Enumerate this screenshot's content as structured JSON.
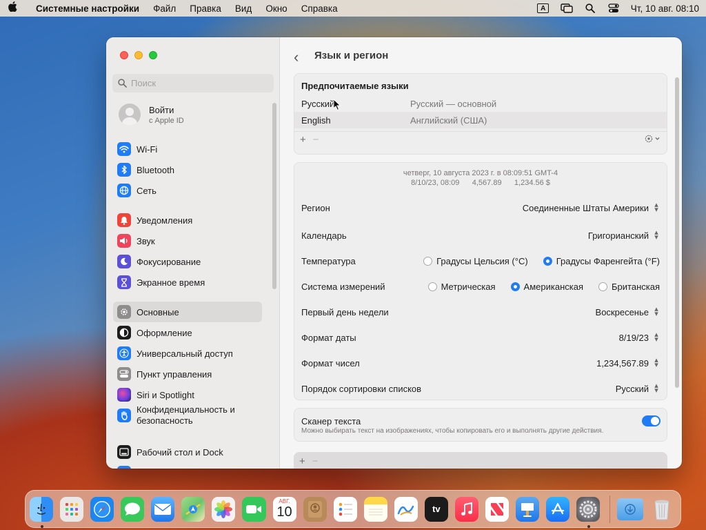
{
  "menubar": {
    "apple": "",
    "app_name": "Системные настройки",
    "menus": [
      "Файл",
      "Правка",
      "Вид",
      "Окно",
      "Справка"
    ],
    "input_indicator": "A",
    "clock": "Чт, 10 авг.  08:10"
  },
  "sidebar": {
    "search_placeholder": "Поиск",
    "account": {
      "name": "Войти",
      "sub": "с Apple ID"
    },
    "items": [
      {
        "label": "Wi-Fi",
        "icon": "wifi-icon",
        "color": "#1f7cf5"
      },
      {
        "label": "Bluetooth",
        "icon": "bluetooth-icon",
        "color": "#1f7cf5"
      },
      {
        "label": "Сеть",
        "icon": "globe-icon",
        "color": "#1f7cf5"
      },
      {
        "label": "Уведомления",
        "icon": "bell-icon",
        "color": "#f0443a"
      },
      {
        "label": "Звук",
        "icon": "speaker-icon",
        "color": "#f0445d"
      },
      {
        "label": "Фокусирование",
        "icon": "moon-icon",
        "color": "#5b50d6"
      },
      {
        "label": "Экранное время",
        "icon": "hourglass-icon",
        "color": "#5b50d6"
      },
      {
        "label": "Основные",
        "icon": "gear-icon",
        "color": "#8e8c8c"
      },
      {
        "label": "Оформление",
        "icon": "appearance-icon",
        "color": "#1d1d1d"
      },
      {
        "label": "Универсальный доступ",
        "icon": "accessibility-icon",
        "color": "#1f7cf5"
      },
      {
        "label": "Пункт управления",
        "icon": "control-center-icon",
        "color": "#8e8c8c"
      },
      {
        "label": "Siri и Spotlight",
        "icon": "siri-icon",
        "color": "#9b3fd6"
      },
      {
        "label": "Конфиденциальность и безопасность",
        "line1": "Конфиденциальность и",
        "line2": "безопасность",
        "icon": "hand-icon",
        "color": "#1f7cf5"
      },
      {
        "label": "Рабочий стол и Dock",
        "icon": "dock-icon",
        "color": "#1d1d1d"
      }
    ]
  },
  "main": {
    "back_label": "‹",
    "title": "Язык и регион",
    "preferred_languages": {
      "header": "Предпочитаемые языки",
      "rows": [
        {
          "name": "Русский",
          "desc": "Русский — основной"
        },
        {
          "name": "English",
          "desc": "Английский (США)"
        }
      ],
      "add": "+",
      "remove": "−",
      "more": "⚙"
    },
    "format_sample": {
      "line1": "четверг, 10 августа 2023 г. в 08:09:51 GMT-4",
      "line2": "8/10/23, 08:09      4,567.89      1,234.56 $"
    },
    "settings": {
      "region": {
        "label": "Регион",
        "value": "Соединенные Штаты Америки"
      },
      "calendar": {
        "label": "Календарь",
        "value": "Григорианский"
      },
      "temperature": {
        "label": "Температура",
        "options": [
          "Градусы Цельсия (°C)",
          "Градусы Фаренгейта (°F)"
        ],
        "selected": 1
      },
      "measurement": {
        "label": "Система измерений",
        "options": [
          "Метрическая",
          "Американская",
          "Британская"
        ],
        "selected": 1
      },
      "first_day": {
        "label": "Первый день недели",
        "value": "Воскресенье"
      },
      "date_format": {
        "label": "Формат даты",
        "value": "8/19/23"
      },
      "number_format": {
        "label": "Формат чисел",
        "value": "1,234,567.89"
      },
      "sort_order": {
        "label": "Порядок сортировки списков",
        "value": "Русский"
      }
    },
    "live_text": {
      "title": "Сканер текста",
      "desc": "Можно выбирать текст на изображениях, чтобы копировать его и выполнять другие действия.",
      "enabled": true
    },
    "bottom_add": "+",
    "bottom_remove": "−"
  },
  "dock": {
    "apps": [
      {
        "name": "finder-icon",
        "color": "#2f8ef5",
        "running": true
      },
      {
        "name": "launchpad-icon",
        "color": "#e9e6e6"
      },
      {
        "name": "safari-icon",
        "color": "#1a86f0"
      },
      {
        "name": "messages-icon",
        "color": "#38c95a"
      },
      {
        "name": "mail-icon",
        "color": "#2a8df5"
      },
      {
        "name": "maps-icon",
        "color": "#6cc46a"
      },
      {
        "name": "photos-icon",
        "color": "#f4f2f2"
      },
      {
        "name": "facetime-icon",
        "color": "#34c759"
      },
      {
        "name": "calendar-icon",
        "color": "#ffffff",
        "month": "АВГ.",
        "day": "10"
      },
      {
        "name": "contacts-icon",
        "color": "#b88a5a"
      },
      {
        "name": "reminders-icon",
        "color": "#ffffff"
      },
      {
        "name": "notes-icon",
        "color": "#ffd84a"
      },
      {
        "name": "freeform-icon",
        "color": "#ffffff"
      },
      {
        "name": "tv-icon",
        "color": "#1b1b1b",
        "label": "tv"
      },
      {
        "name": "music-icon",
        "color": "#fb3b54"
      },
      {
        "name": "news-icon",
        "color": "#ffffff"
      },
      {
        "name": "keynote-icon",
        "color": "#2d8cf0"
      },
      {
        "name": "app-store-icon",
        "color": "#1a8df5"
      },
      {
        "name": "system-settings-icon",
        "color": "#7d7d80",
        "running": true
      }
    ],
    "folders": [
      {
        "name": "downloads-folder-icon",
        "color": "#5aa9ef"
      },
      {
        "name": "trash-icon",
        "color": "#d7d7d9"
      }
    ]
  }
}
